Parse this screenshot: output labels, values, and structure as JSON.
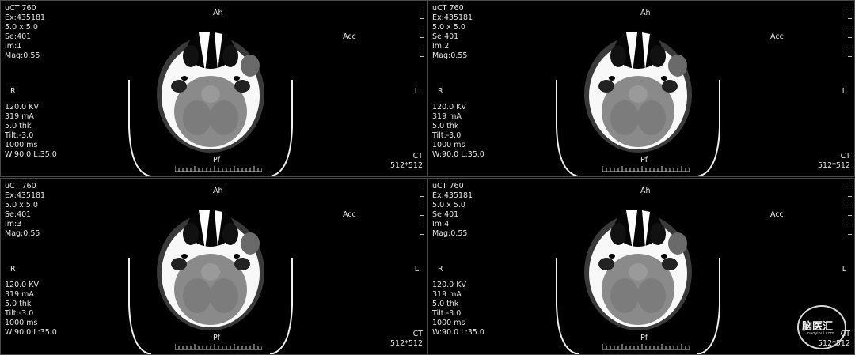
{
  "viewer": {
    "viewports": [
      {
        "top_left": [
          "uCT 760",
          "Ex:435181",
          "5.0 x 5.0",
          "Se:401",
          "Im:1",
          "Mag:0.55"
        ],
        "bottom_left": [
          "120.0 KV",
          "319 mA",
          "5.0 thk",
          "Tilt:-3.0",
          "1000 ms",
          "W:90.0 L:35.0"
        ],
        "orient_right": "R",
        "orient_left": "L",
        "orient_anterior": "Ah",
        "orient_posterior": "Pf",
        "acc_label": "Acc",
        "modality": "CT",
        "matrix": "512*512"
      },
      {
        "top_left": [
          "uCT 760",
          "Ex:435181",
          "5.0 x 5.0",
          "Se:401",
          "Im:2",
          "Mag:0.55"
        ],
        "bottom_left": [
          "120.0 KV",
          "319 mA",
          "5.0 thk",
          "Tilt:-3.0",
          "1000 ms",
          "W:90.0 L:35.0"
        ],
        "orient_right": "R",
        "orient_left": "L",
        "orient_anterior": "Ah",
        "orient_posterior": "Pf",
        "acc_label": "Acc",
        "modality": "CT",
        "matrix": "512*512"
      },
      {
        "top_left": [
          "uCT 760",
          "Ex:435181",
          "5.0 x 5.0",
          "Se:401",
          "Im:3",
          "Mag:0.55"
        ],
        "bottom_left": [
          "120.0 KV",
          "319 mA",
          "5.0 thk",
          "Tilt:-3.0",
          "1000 ms",
          "W:90.0 L:35.0"
        ],
        "orient_right": "R",
        "orient_left": "L",
        "orient_anterior": "Ah",
        "orient_posterior": "Pf",
        "acc_label": "Acc",
        "modality": "CT",
        "matrix": "512*512"
      },
      {
        "top_left": [
          "uCT 760",
          "Ex:435181",
          "5.0 x 5.0",
          "Se:401",
          "Im:4",
          "Mag:0.55"
        ],
        "bottom_left": [
          "120.0 KV",
          "319 mA",
          "5.0 thk",
          "Tilt:-3.0",
          "1000 ms",
          "W:90.0 L:35.0"
        ],
        "orient_right": "R",
        "orient_left": "L",
        "orient_anterior": "Ah",
        "orient_posterior": "Pf",
        "acc_label": "Acc",
        "modality": "CT",
        "matrix": "512*512"
      }
    ]
  },
  "watermark": {
    "text": "脑医汇",
    "subtext": "naoyihui.com"
  },
  "colors": {
    "background": "#000000",
    "overlay_text": "#e6e6e6",
    "bone": "#ffffff",
    "brain": "#8a8a8a",
    "viewport_border": "#4a4a4a"
  }
}
